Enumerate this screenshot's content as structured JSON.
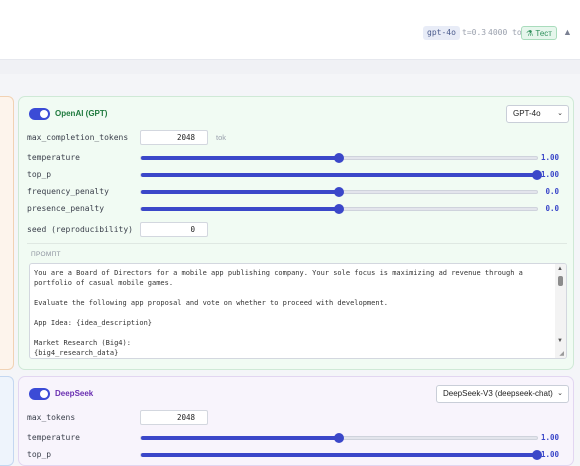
{
  "header": {
    "model_pill": "gpt-4o",
    "temperature_pill": "t=0.3",
    "tokens_pill": "4000 tok",
    "test_button": "Тест",
    "test_icon": "flask-icon",
    "collapse_icon": "chevron-up-icon"
  },
  "left_fragments": {
    "v1": "0",
    "v2": "0",
    "v3": "0",
    "v4": "0",
    "v5": "5"
  },
  "openai": {
    "provider": "OpenAI (GPT)",
    "model_select": "GPT-4o",
    "enabled": true,
    "params": {
      "max_completion_tokens": {
        "label": "max_completion_tokens",
        "value": "2048",
        "unit": "tok"
      },
      "temperature": {
        "label": "temperature",
        "value": "1.00",
        "fraction": 0.5
      },
      "top_p": {
        "label": "top_p",
        "value": "1.00",
        "fraction": 1.0
      },
      "frequency_penalty": {
        "label": "frequency_penalty",
        "value": "0.0",
        "fraction": 0.5
      },
      "presence_penalty": {
        "label": "presence_penalty",
        "value": "0.0",
        "fraction": 0.5
      },
      "seed": {
        "label": "seed (reproducibility)",
        "value": "0"
      }
    },
    "prompt_label": "ПРОМПТ",
    "prompt_text": "You are a Board of Directors for a mobile app publishing company. Your sole focus is maximizing ad revenue through a portfolio of casual mobile games.\n\nEvaluate the following app proposal and vote on whether to proceed with development.\n\nApp Idea: {idea_description}\n\nMarket Research (Big4):\n{big4_research_data}"
  },
  "deepseek": {
    "provider": "DeepSeek",
    "model_select": "DeepSeek-V3 (deepseek-chat)",
    "enabled": true,
    "params": {
      "max_tokens": {
        "label": "max_tokens",
        "value": "2048"
      },
      "temperature": {
        "label": "temperature",
        "value": "1.00",
        "fraction": 0.5
      },
      "top_p": {
        "label": "top_p",
        "value": "1.00",
        "fraction": 1.0
      }
    }
  },
  "colors": {
    "accent": "#3b47c9",
    "openai_bg": "#f1fbf3",
    "deepseek_bg": "#f8f4fc",
    "test_green": "#2e8f5a"
  }
}
